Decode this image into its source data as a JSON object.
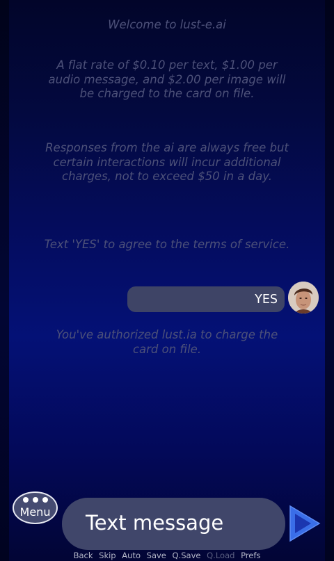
{
  "messages": {
    "welcome": "Welcome to lust-e.ai",
    "rates": "A flat rate of $0.10 per text, $1.00 per audio message, and $2.00 per image will be charged to the card on file.",
    "responses": "Responses from the ai are always free but certain interactions will incur additional charges, not to exceed $50 in a day.",
    "terms": "Text 'YES' to agree to the terms of service.",
    "authorized": "You've authorized lust.ia to charge the card on file."
  },
  "user_reply": {
    "text": "YES"
  },
  "input": {
    "placeholder": "Text message"
  },
  "menu_button": {
    "label": "Menu",
    "icon": "three-dots-icon"
  },
  "send_button": {
    "icon": "play-arrow-icon"
  },
  "quick_menu": {
    "back": "Back",
    "skip": "Skip",
    "auto": "Auto",
    "save": "Save",
    "qsave": "Q.Save",
    "qload": "Q.Load",
    "prefs": "Prefs"
  },
  "colors": {
    "background": "#040d63",
    "system_text": "#4d5179",
    "bubble": "#3e4466",
    "accent": "#2b5ad8"
  }
}
